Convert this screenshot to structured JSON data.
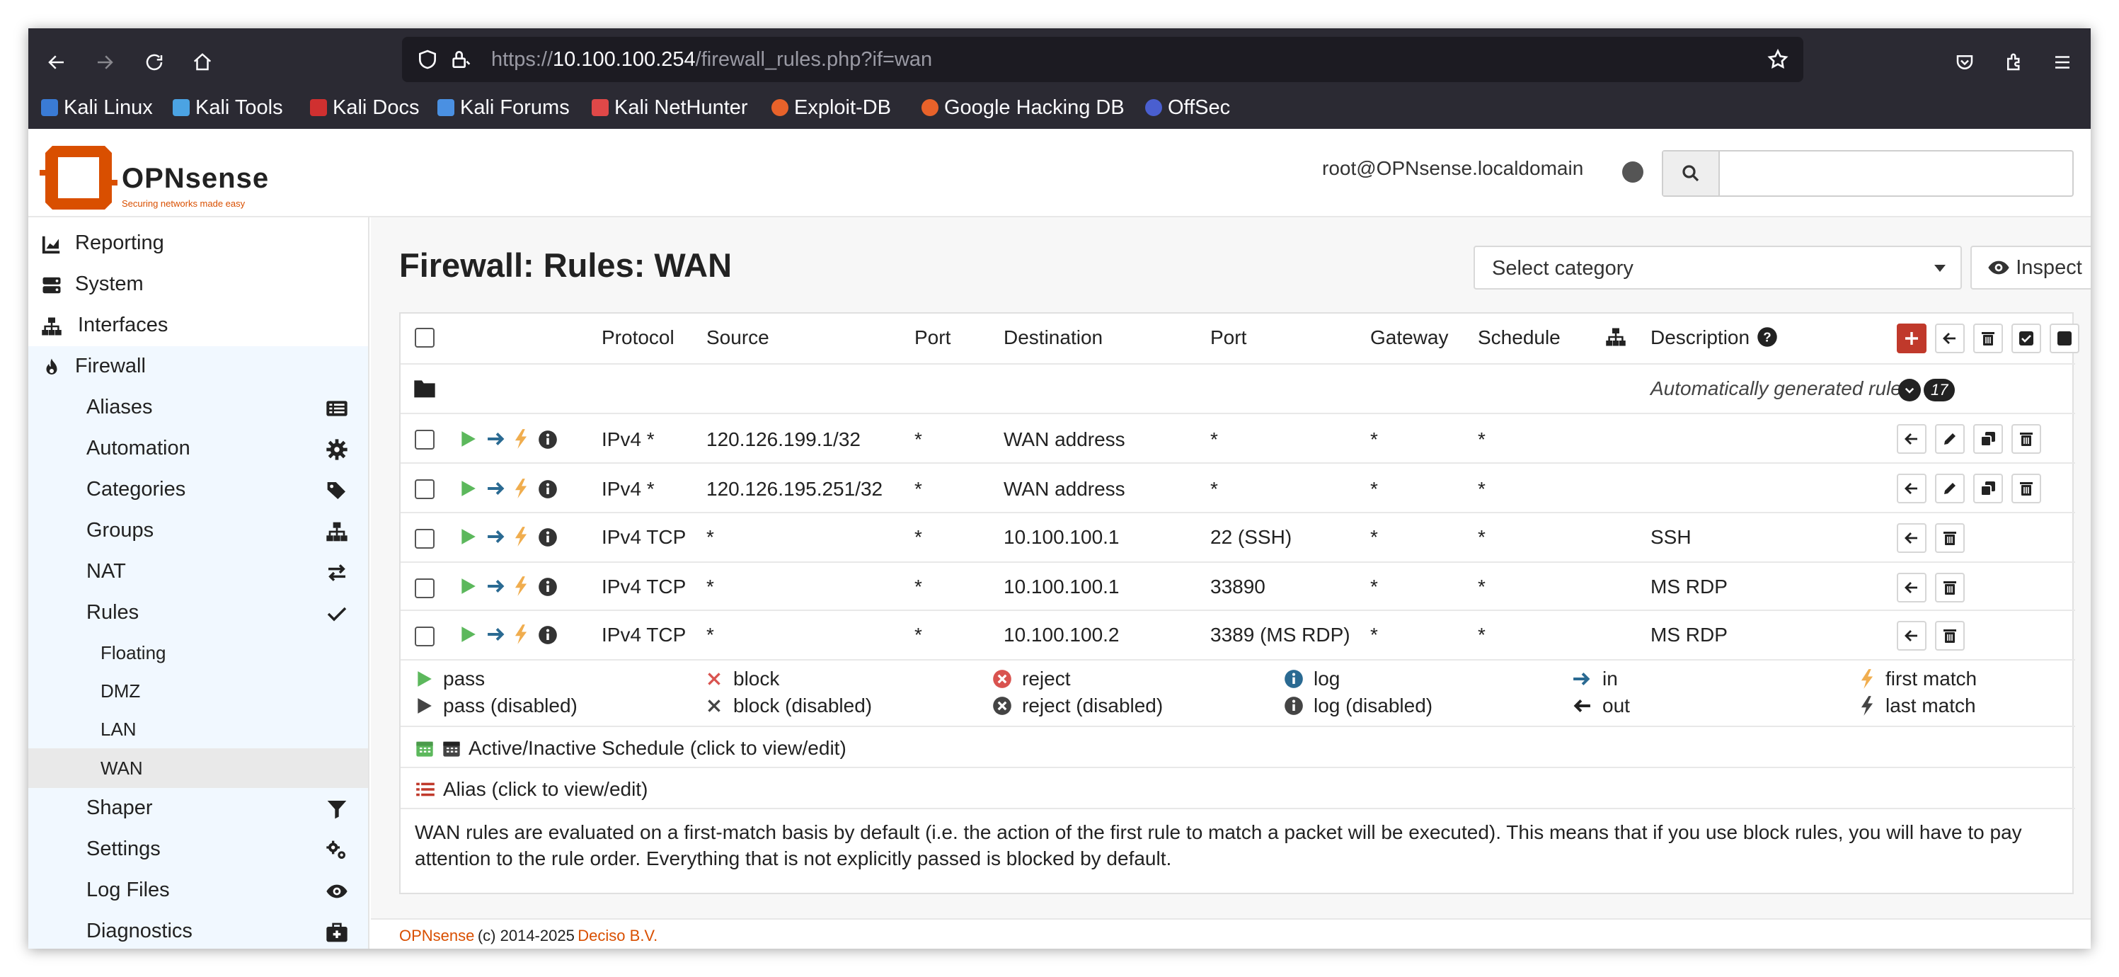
{
  "browser": {
    "url_scheme": "https://",
    "url_host": "10.100.100.254",
    "url_path": "/firewall_rules.php?if=wan",
    "bookmarks": [
      "Kali Linux",
      "Kali Tools",
      "Kali Docs",
      "Kali Forums",
      "Kali NetHunter",
      "Exploit-DB",
      "Google Hacking DB",
      "OffSec"
    ]
  },
  "header": {
    "brand": "OPNsense",
    "tagline": "Securing networks made easy",
    "user": "root@OPNsense.localdomain",
    "search_placeholder": ""
  },
  "sidebar": {
    "items": [
      {
        "label": "Reporting",
        "icon": "chart-area-icon"
      },
      {
        "label": "System",
        "icon": "server-icon"
      },
      {
        "label": "Interfaces",
        "icon": "sitemap-icon"
      },
      {
        "label": "Firewall",
        "icon": "fire-icon"
      },
      {
        "label": "Aliases",
        "icon": "list-icon"
      },
      {
        "label": "Automation",
        "icon": "cog-icon"
      },
      {
        "label": "Categories",
        "icon": "tags-icon"
      },
      {
        "label": "Groups",
        "icon": "sitemap-icon"
      },
      {
        "label": "NAT",
        "icon": "exchange-icon"
      },
      {
        "label": "Rules",
        "icon": "check-icon"
      },
      {
        "label": "Floating"
      },
      {
        "label": "DMZ"
      },
      {
        "label": "LAN"
      },
      {
        "label": "WAN"
      },
      {
        "label": "Shaper",
        "icon": "filter-icon"
      },
      {
        "label": "Settings",
        "icon": "cogs-icon"
      },
      {
        "label": "Log Files",
        "icon": "eye-icon"
      },
      {
        "label": "Diagnostics",
        "icon": "medkit-icon"
      }
    ]
  },
  "page": {
    "title": "Firewall: Rules: WAN",
    "select_category": "Select category",
    "inspect_label": "Inspect"
  },
  "table": {
    "headers": {
      "protocol": "Protocol",
      "source": "Source",
      "port": "Port",
      "destination": "Destination",
      "dport": "Port",
      "gateway": "Gateway",
      "schedule": "Schedule",
      "description": "Description"
    },
    "auto_rules_label": "Automatically generated rules",
    "auto_rules_count": "17",
    "rows": [
      {
        "protocol": "IPv4 *",
        "source": "120.126.199.1/32",
        "port": "*",
        "destination": "WAN address",
        "dport": "*",
        "gateway": "*",
        "schedule": "*",
        "description": ""
      },
      {
        "protocol": "IPv4 *",
        "source": "120.126.195.251/32",
        "port": "*",
        "destination": "WAN address",
        "dport": "*",
        "gateway": "*",
        "schedule": "*",
        "description": ""
      },
      {
        "protocol": "IPv4 TCP",
        "source": "*",
        "port": "*",
        "destination": "10.100.100.1",
        "dport": "22 (SSH)",
        "gateway": "*",
        "schedule": "*",
        "description": "SSH"
      },
      {
        "protocol": "IPv4 TCP",
        "source": "*",
        "port": "*",
        "destination": "10.100.100.1",
        "dport": "33890",
        "gateway": "*",
        "schedule": "*",
        "description": "MS RDP"
      },
      {
        "protocol": "IPv4 TCP",
        "source": "*",
        "port": "*",
        "destination": "10.100.100.2",
        "dport": "3389 (MS RDP)",
        "gateway": "*",
        "schedule": "*",
        "description": "MS RDP"
      }
    ]
  },
  "legend": {
    "pass": "pass",
    "pass_disabled": "pass (disabled)",
    "block": "block",
    "block_disabled": "block (disabled)",
    "reject": "reject",
    "reject_disabled": "reject (disabled)",
    "log": "log",
    "log_disabled": "log (disabled)",
    "in": "in",
    "out": "out",
    "first_match": "first match",
    "last_match": "last match",
    "schedule": "Active/Inactive Schedule (click to view/edit)",
    "alias": "Alias (click to view/edit)",
    "note": "WAN rules are evaluated on a first-match basis by default (i.e. the action of the first rule to match a packet will be executed). This means that if you use block rules, you will have to pay attention to the rule order. Everything that is not explicitly passed is blocked by default."
  },
  "footer": {
    "brand": "OPNsense",
    "copyright": "(c) 2014-2025",
    "company": "Deciso B.V."
  },
  "colors": {
    "accent": "#d94f00",
    "add_button": "#c0392b",
    "pass": "#5cb85c",
    "in_arrow": "#2a6a92",
    "first_match": "#f0ad4e",
    "sidebar_active": "#eaeaea"
  }
}
